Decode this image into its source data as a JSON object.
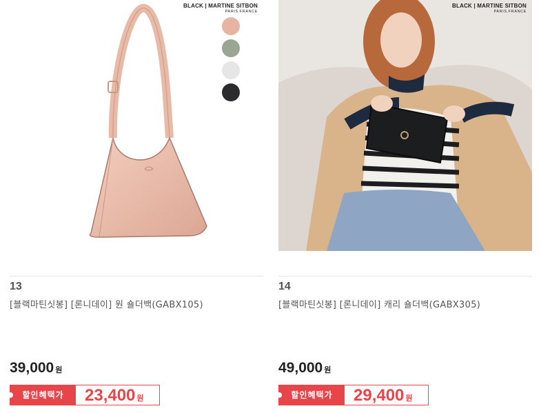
{
  "products": [
    {
      "rank": "13",
      "brand_line1": "BLACK | MARTINE SITBON",
      "brand_line2": "PARIS.FRANCE",
      "title": "[블랙마틴싯봉] [론니데이] 원 숄더백(GABX105)",
      "price": "39,000",
      "currency": "원",
      "promo_label": "할인혜택가",
      "promo_price": "23,400",
      "swatch_colors": [
        "#e6b4a0",
        "#9aa592",
        "#e6e6e6",
        "#2b2b2d"
      ]
    },
    {
      "rank": "14",
      "brand_line1": "BLACK | MARTINE SITBON",
      "brand_line2": "PARIS.FRANCE",
      "title": "[블랙마틴싯봉] [론니데이] 캐리 숄더백(GABX305)",
      "price": "49,000",
      "currency": "원",
      "promo_label": "할인혜택가",
      "promo_price": "29,400"
    }
  ],
  "colors": {
    "accent": "#e8454b",
    "text": "#555555",
    "price": "#222222"
  }
}
